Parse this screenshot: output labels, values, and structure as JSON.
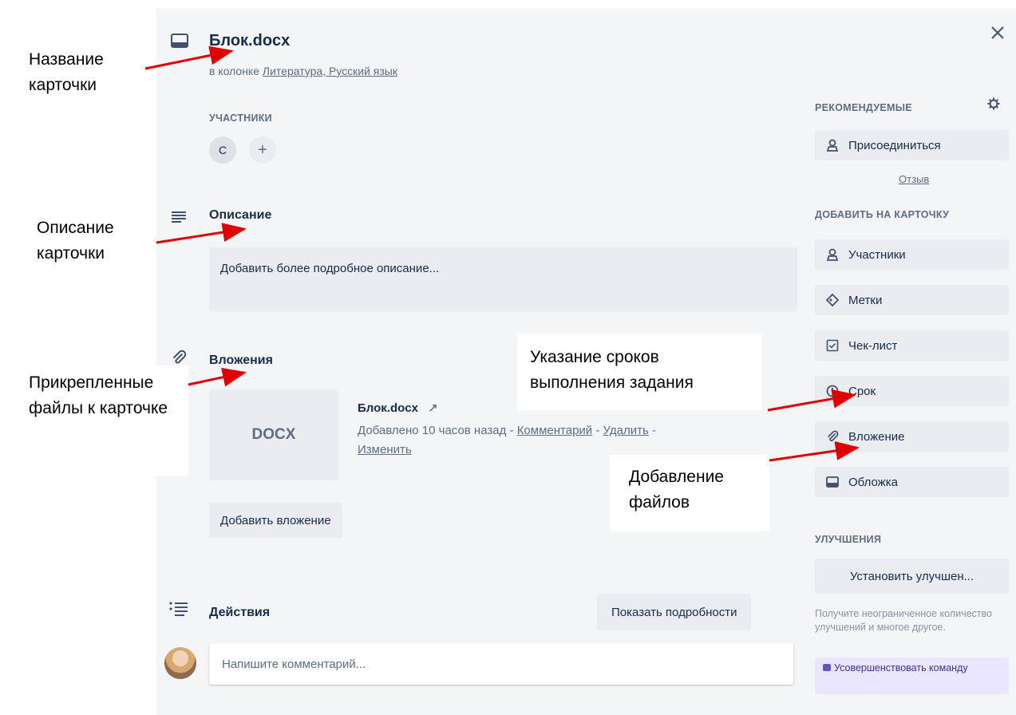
{
  "card": {
    "title": "Блок.docx",
    "in_column_prefix": "в колонке ",
    "column_link": "Литература, Русский язык"
  },
  "members": {
    "heading": "УЧАСТНИКИ",
    "initial": "С",
    "add_symbol": "+"
  },
  "description": {
    "heading": "Описание",
    "placeholder": "Добавить более подробное описание..."
  },
  "attachments": {
    "heading": "Вложения",
    "thumb_label": "DOCX",
    "file_name": "Блок.docx",
    "arrow": "↗",
    "added_text": "Добавлено 10 часов назад - ",
    "comment_link": "Комментарий",
    "sep": " - ",
    "delete_link": "Удалить",
    "edit_link": "Изменить",
    "add_button": "Добавить вложение"
  },
  "activity": {
    "heading": "Действия",
    "show_details": "Показать подробности",
    "comment_placeholder": "Напишите комментарий..."
  },
  "sidebar": {
    "recommended_heading": "РЕКОМЕНДУЕМЫЕ",
    "join_button": "Присоединиться",
    "feedback_link": "Отзыв",
    "add_to_card_heading": "ДОБАВИТЬ НА КАРТОЧКУ",
    "items": [
      {
        "label": "Участники",
        "icon": "person-icon"
      },
      {
        "label": "Метки",
        "icon": "tag-icon"
      },
      {
        "label": "Чек-лист",
        "icon": "checklist-icon"
      },
      {
        "label": "Срок",
        "icon": "clock-icon"
      },
      {
        "label": "Вложение",
        "icon": "paperclip-icon"
      },
      {
        "label": "Обложка",
        "icon": "cover-icon"
      }
    ],
    "powerups_heading": "УЛУЧШЕНИЯ",
    "powerups_button": "Установить улучшен...",
    "powerups_note": "Получите неограниченное количество улучшений и многое другое.",
    "upgrade_button": "Усовершенствовать команду"
  },
  "annotations": {
    "card_name": "Название карточки",
    "card_description": "Описание карточки",
    "attached_files": "Прикрепленные файлы к карточке",
    "due_dates": "Указание сроков выполнения задания",
    "add_files": "Добавление файлов"
  },
  "colors": {
    "modal_bg": "#f4f5f7",
    "button_bg": "#ebecf0",
    "text": "#172b4d",
    "muted": "#5e6c84",
    "arrow": "#e00000",
    "promo_bg": "#eae6ff"
  }
}
